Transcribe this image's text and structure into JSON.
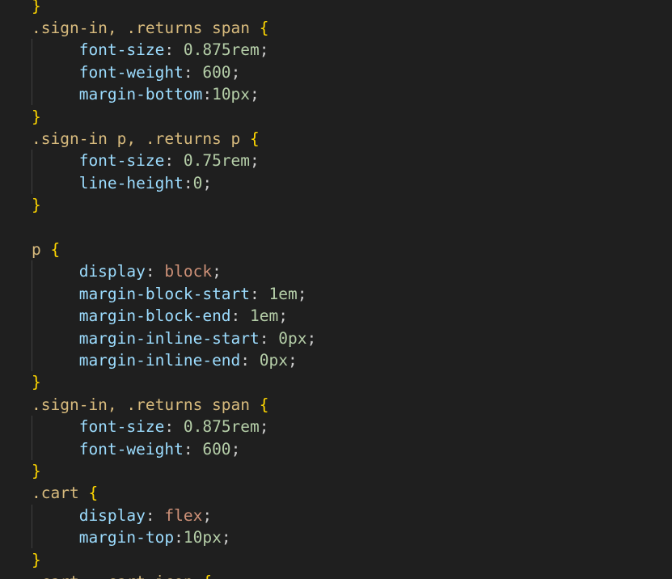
{
  "editor": {
    "language": "css",
    "theme_colors": {
      "background": "#1f1f1f",
      "selector": "#d7ba7d",
      "brace": "#ffd700",
      "property": "#9cdcfe",
      "number": "#b5cea8",
      "keyword_value": "#ce9178",
      "punctuation": "#cccccc",
      "indent_guide": "#404040"
    },
    "lines": [
      {
        "kind": "close",
        "brace": "}"
      },
      {
        "kind": "open",
        "selector": ".sign-in, .returns span",
        "brace": "{"
      },
      {
        "kind": "decl",
        "prop": "font-size",
        "sep": ": ",
        "value": "0.875rem",
        "vtype": "num",
        "end": ";"
      },
      {
        "kind": "decl",
        "prop": "font-weight",
        "sep": ": ",
        "value": "600",
        "vtype": "num",
        "end": ";"
      },
      {
        "kind": "decl",
        "prop": "margin-bottom",
        "sep": ":",
        "value": "10px",
        "vtype": "num",
        "end": ";"
      },
      {
        "kind": "close",
        "brace": "}"
      },
      {
        "kind": "open",
        "selector": ".sign-in p, .returns p",
        "brace": "{"
      },
      {
        "kind": "decl",
        "prop": "font-size",
        "sep": ": ",
        "value": "0.75rem",
        "vtype": "num",
        "end": ";"
      },
      {
        "kind": "decl",
        "prop": "line-height",
        "sep": ":",
        "value": "0",
        "vtype": "num",
        "end": ";"
      },
      {
        "kind": "close",
        "brace": "}"
      },
      {
        "kind": "blank"
      },
      {
        "kind": "open",
        "selector": "p",
        "brace": "{"
      },
      {
        "kind": "decl",
        "prop": "display",
        "sep": ": ",
        "value": "block",
        "vtype": "kw",
        "end": ";"
      },
      {
        "kind": "decl",
        "prop": "margin-block-start",
        "sep": ": ",
        "value": "1em",
        "vtype": "num",
        "end": ";"
      },
      {
        "kind": "decl",
        "prop": "margin-block-end",
        "sep": ": ",
        "value": "1em",
        "vtype": "num",
        "end": ";"
      },
      {
        "kind": "decl",
        "prop": "margin-inline-start",
        "sep": ": ",
        "value": "0px",
        "vtype": "num",
        "end": ";"
      },
      {
        "kind": "decl",
        "prop": "margin-inline-end",
        "sep": ": ",
        "value": "0px",
        "vtype": "num",
        "end": ";"
      },
      {
        "kind": "close",
        "brace": "}"
      },
      {
        "kind": "open",
        "selector": ".sign-in, .returns span",
        "brace": "{"
      },
      {
        "kind": "decl",
        "prop": "font-size",
        "sep": ": ",
        "value": "0.875rem",
        "vtype": "num",
        "end": ";"
      },
      {
        "kind": "decl",
        "prop": "font-weight",
        "sep": ": ",
        "value": "600",
        "vtype": "num",
        "end": ";"
      },
      {
        "kind": "close",
        "brace": "}"
      },
      {
        "kind": "open",
        "selector": ".cart",
        "brace": "{"
      },
      {
        "kind": "decl",
        "prop": "display",
        "sep": ": ",
        "value": "flex",
        "vtype": "kw",
        "end": ";"
      },
      {
        "kind": "decl",
        "prop": "margin-top",
        "sep": ":",
        "value": "10px",
        "vtype": "num",
        "end": ";"
      },
      {
        "kind": "close",
        "brace": "}"
      },
      {
        "kind": "open",
        "selector": ".cart, .cart-icon",
        "brace": "{"
      }
    ]
  }
}
